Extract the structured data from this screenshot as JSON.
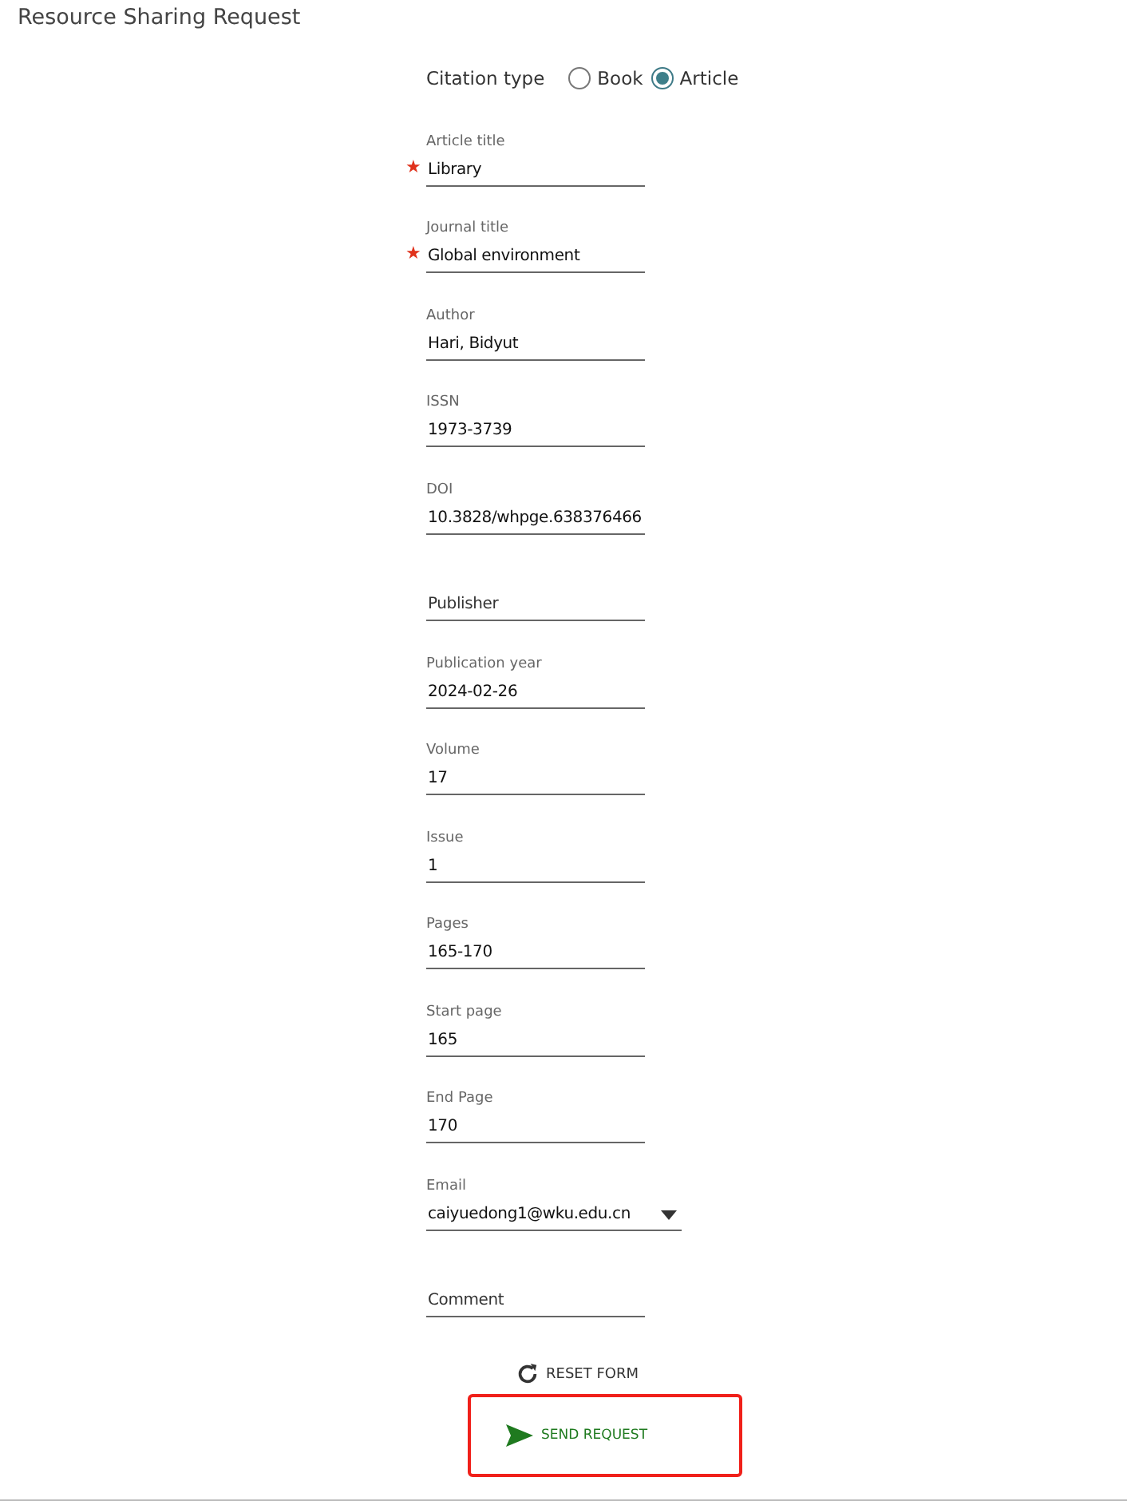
{
  "page_title": "Resource Sharing Request",
  "citation_type": {
    "label": "Citation type",
    "options": [
      {
        "label": "Book",
        "selected": false
      },
      {
        "label": "Article",
        "selected": true
      }
    ]
  },
  "required_mark": "★",
  "fields": [
    {
      "kind": "text",
      "label": "Article title",
      "value": "Library",
      "required": true
    },
    {
      "kind": "text",
      "label": "Journal title",
      "value": "Global environment",
      "required": true
    },
    {
      "kind": "text",
      "label": "Author",
      "value": "Hari, Bidyut",
      "required": false
    },
    {
      "kind": "text",
      "label": "ISSN",
      "value": "1973-3739",
      "required": false
    },
    {
      "kind": "text",
      "label": "DOI",
      "value": "10.3828/whpge.638376466",
      "required": false
    },
    {
      "kind": "text",
      "placeholder": "Publisher",
      "required": false
    },
    {
      "kind": "text",
      "label": "Publication year",
      "value": "2024-02-26",
      "required": false
    },
    {
      "kind": "text",
      "label": "Volume",
      "value": "17",
      "required": false
    },
    {
      "kind": "text",
      "label": "Issue",
      "value": "1",
      "required": false
    },
    {
      "kind": "text",
      "label": "Pages",
      "value": "165-170",
      "required": false
    },
    {
      "kind": "text",
      "label": "Start page",
      "value": "165",
      "required": false
    },
    {
      "kind": "text",
      "label": "End Page",
      "value": "170",
      "required": false
    },
    {
      "kind": "select",
      "label": "Email",
      "value": "caiyuedong1@wku.edu.cn",
      "required": false
    },
    {
      "kind": "text",
      "placeholder": "Comment",
      "required": false
    }
  ],
  "reset_button": {
    "label": "RESET FORM"
  },
  "send_button": {
    "label": "SEND REQUEST",
    "highlighted": true
  }
}
